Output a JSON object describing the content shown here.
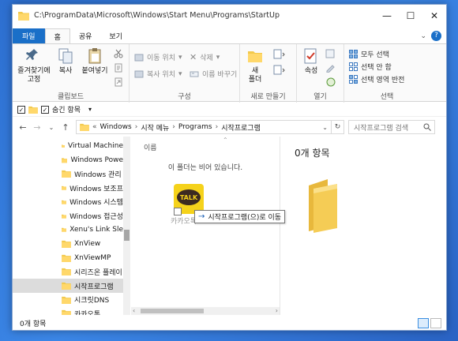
{
  "window": {
    "title_path": "C:\\ProgramData\\Microsoft\\Windows\\Start Menu\\Programs\\StartUp"
  },
  "controls": {
    "minimize": "—",
    "maximize": "☐",
    "close": "✕"
  },
  "tabs": [
    {
      "label": "파일"
    },
    {
      "label": "홈"
    },
    {
      "label": "공유"
    },
    {
      "label": "보기"
    }
  ],
  "ribbon": {
    "clipboard": {
      "pin_label": "즐겨찾기에\n고정",
      "copy_label": "복사",
      "paste_label": "붙여넣기",
      "group_label": "클립보드"
    },
    "organize": {
      "move_to": "이동 위치",
      "copy_to": "복사 위치",
      "delete": "삭제",
      "rename": "이름 바꾸기",
      "group_label": "구성"
    },
    "new": {
      "new_folder": "새\n폴더",
      "group_label": "새로 만들기"
    },
    "open": {
      "properties": "속성",
      "group_label": "열기"
    },
    "select": {
      "select_all": "모두 선택",
      "select_none": "선택 안 함",
      "invert": "선택 영역 반전",
      "group_label": "선택"
    }
  },
  "qat": {
    "hidden_items_label": "숨긴 항목"
  },
  "address": {
    "crumbs": [
      "Windows",
      "시작 메뉴",
      "Programs",
      "시작프로그램"
    ],
    "search_placeholder": "시작프로그램 검색"
  },
  "nav_items": [
    {
      "label": "Virtual Machine"
    },
    {
      "label": "Windows Powe"
    },
    {
      "label": "Windows 관리"
    },
    {
      "label": "Windows 보조프"
    },
    {
      "label": "Windows 시스템"
    },
    {
      "label": "Windows 접근성"
    },
    {
      "label": "Xenu's Link Sle"
    },
    {
      "label": "XnView"
    },
    {
      "label": "XnViewMP"
    },
    {
      "label": "시리즈온 플레이"
    },
    {
      "label": "시작프로그램",
      "selected": true
    },
    {
      "label": "시크릿DNS"
    },
    {
      "label": "카카오톡"
    }
  ],
  "content": {
    "column_name": "이름",
    "empty_message": "이 폴더는 비어 있습니다.",
    "drag_item_label": "카카오톡",
    "drag_icon_text": "TALK",
    "drag_tooltip": "시작프로그램(으)로 이동"
  },
  "preview": {
    "count": "0개 항목"
  },
  "status": {
    "count": "0개 항목"
  }
}
